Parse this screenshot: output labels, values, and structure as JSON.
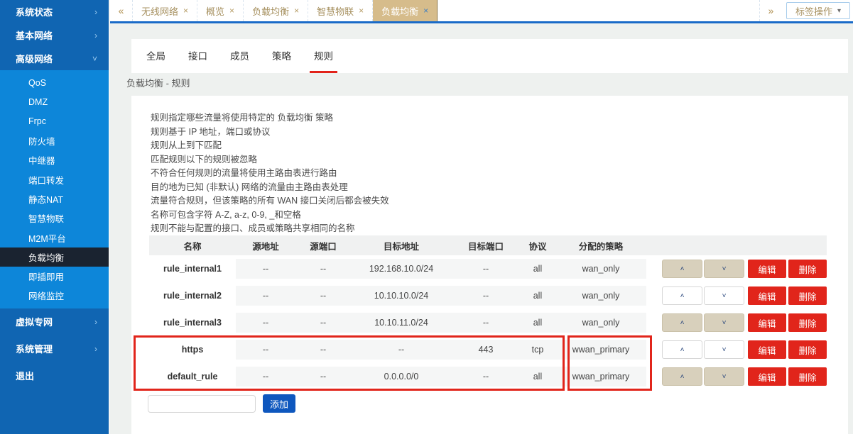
{
  "icons": {
    "collapse_tabs": "«",
    "expand_tabs": "»",
    "close": "×",
    "caret_down": "▾",
    "chevron_right": "›",
    "chevron_down": "˅",
    "move_up": "˄",
    "move_down": "˅"
  },
  "colors": {
    "sidebar_blue": "#1065b2",
    "submenu_blue": "#0d86d9",
    "active_item_dark": "#1a2330",
    "tab_gold_text": "#a79160",
    "active_tab_tan": "#d6bc8b",
    "tabbar_underline_blue": "#1a6bc8",
    "accent_red": "#e1251b",
    "add_button_blue": "#0e57be"
  },
  "sidebar": {
    "top_items": [
      {
        "label": "系统状态",
        "chevron": "›"
      },
      {
        "label": "基本网络",
        "chevron": "›"
      },
      {
        "label": "高级网络",
        "chevron": "˅"
      }
    ],
    "submenu_items": [
      {
        "label": "QoS"
      },
      {
        "label": "DMZ"
      },
      {
        "label": "Frpc"
      },
      {
        "label": "防火墙"
      },
      {
        "label": "中继器"
      },
      {
        "label": "端口转发"
      },
      {
        "label": "静态NAT"
      },
      {
        "label": "智慧物联"
      },
      {
        "label": "M2M平台"
      },
      {
        "label": "负载均衡",
        "active": true
      },
      {
        "label": "即插即用"
      },
      {
        "label": "网络监控"
      }
    ],
    "bottom_items": [
      {
        "label": "虚拟专网",
        "chevron": "›"
      },
      {
        "label": "系统管理",
        "chevron": "›"
      },
      {
        "label": "退出",
        "chevron": ""
      }
    ]
  },
  "tabbar": {
    "tabs": [
      {
        "label": "无线网络"
      },
      {
        "label": "概览"
      },
      {
        "label": "负载均衡"
      },
      {
        "label": "智慧物联"
      },
      {
        "label": "负载均衡",
        "active": true
      }
    ],
    "tag_ops_label": "标签操作"
  },
  "subtabs": [
    {
      "label": "全局"
    },
    {
      "label": "接口"
    },
    {
      "label": "成员"
    },
    {
      "label": "策略"
    },
    {
      "label": "规则",
      "active": true
    }
  ],
  "breadcrumb": "负载均衡 - 规则",
  "description_lines": [
    "规则指定哪些流量将使用特定的 负载均衡 策略",
    "规则基于 IP 地址，端口或协议",
    "规则从上到下匹配",
    "匹配规则以下的规则被忽略",
    "不符合任何规则的流量将使用主路由表进行路由",
    "目的地为已知 (非默认) 网络的流量由主路由表处理",
    "流量符合规则，但该策略的所有 WAN 接口关闭后都会被失效",
    "名称可包含字符 A-Z, a-z, 0-9, _和空格",
    "规则不能与配置的接口、成员或策略共享相同的名称"
  ],
  "table": {
    "headers": [
      "名称",
      "源地址",
      "源端口",
      "目标地址",
      "目标端口",
      "协议",
      "分配的策略"
    ],
    "rows": [
      {
        "name": "rule_internal1",
        "src_addr": "--",
        "src_port": "--",
        "dst_addr": "192.168.10.0/24",
        "dst_port": "--",
        "proto": "all",
        "policy": "wan_only"
      },
      {
        "name": "rule_internal2",
        "src_addr": "--",
        "src_port": "--",
        "dst_addr": "10.10.10.0/24",
        "dst_port": "--",
        "proto": "all",
        "policy": "wan_only"
      },
      {
        "name": "rule_internal3",
        "src_addr": "--",
        "src_port": "--",
        "dst_addr": "10.10.11.0/24",
        "dst_port": "--",
        "proto": "all",
        "policy": "wan_only"
      },
      {
        "name": "https",
        "src_addr": "--",
        "src_port": "--",
        "dst_addr": "--",
        "dst_port": "443",
        "proto": "tcp",
        "policy": "wwan_primary"
      },
      {
        "name": "default_rule",
        "src_addr": "--",
        "src_port": "--",
        "dst_addr": "0.0.0.0/0",
        "dst_port": "--",
        "proto": "all",
        "policy": "wwan_primary"
      }
    ],
    "actions": {
      "up": "˄",
      "down": "˅",
      "edit": "编辑",
      "delete": "删除"
    }
  },
  "add": {
    "input_value": "",
    "add_label": "添加"
  }
}
